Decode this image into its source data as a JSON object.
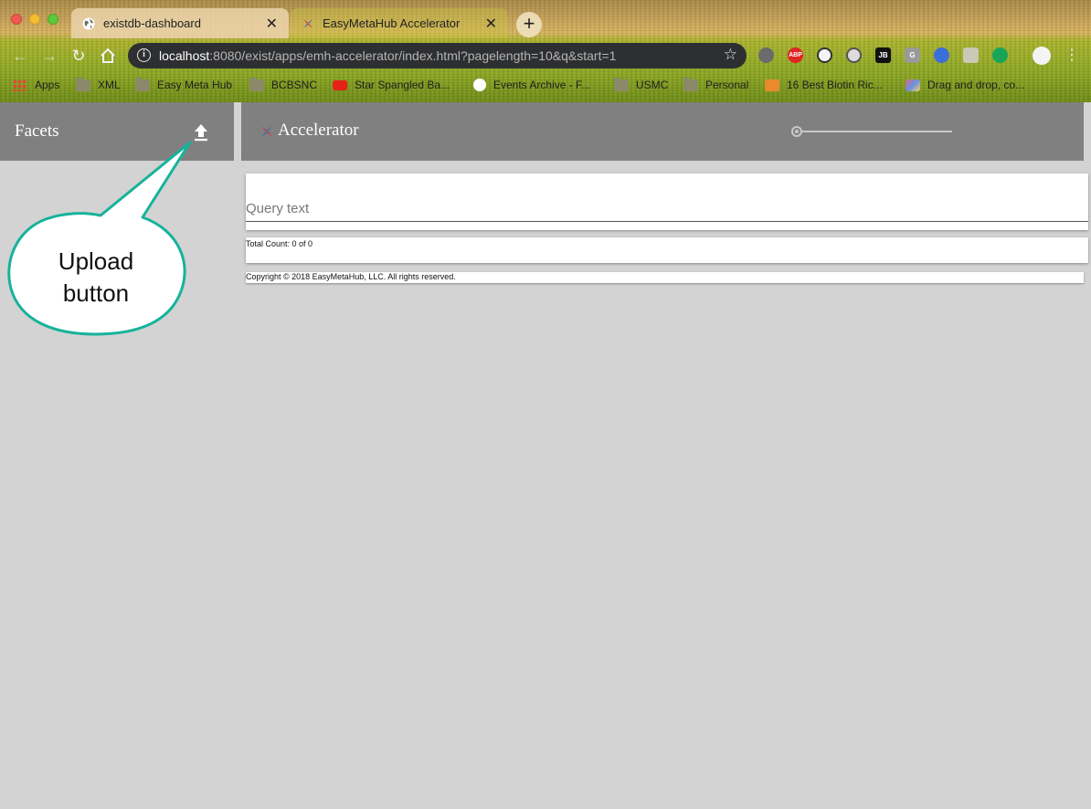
{
  "browser": {
    "tabs": [
      {
        "title": "existdb-dashboard",
        "active": false
      },
      {
        "title": "EasyMetaHub Accelerator",
        "active": true
      }
    ],
    "address": {
      "host": "localhost",
      "rest": ":8080/exist/apps/emh-accelerator/index.html?pagelength=10&q&start=1"
    },
    "extensions": [
      {
        "icon": "settings-extension-icon",
        "label": ""
      },
      {
        "icon": "adblock-plus-icon",
        "label": "ABP"
      },
      {
        "icon": "extension-icon",
        "label": ""
      },
      {
        "icon": "extension-icon",
        "label": ""
      },
      {
        "icon": "jetbrains-icon",
        "label": "JB"
      },
      {
        "icon": "g-extension-icon",
        "label": "G"
      },
      {
        "icon": "extension-icon",
        "label": ""
      },
      {
        "icon": "extension-icon",
        "label": ""
      },
      {
        "icon": "green-dot-extension-icon",
        "label": ""
      }
    ],
    "bookmarks": [
      {
        "label": "Apps",
        "icon": "apps-grid-icon"
      },
      {
        "label": "XML",
        "icon": "folder-icon"
      },
      {
        "label": "Easy Meta Hub",
        "icon": "folder-icon"
      },
      {
        "label": "BCBSNC",
        "icon": "folder-icon"
      },
      {
        "label": "Star Spangled Ba...",
        "icon": "youtube-icon"
      },
      {
        "label": "Events Archive - F...",
        "icon": "globe-icon"
      },
      {
        "label": "USMC",
        "icon": "folder-icon"
      },
      {
        "label": "Personal",
        "icon": "folder-icon"
      },
      {
        "label": "16 Best Biotin Ric...",
        "icon": "keto-site-icon"
      },
      {
        "label": "Drag and drop, co...",
        "icon": "cube-icon"
      }
    ]
  },
  "app": {
    "sidebar_title": "Facets",
    "title": "Accelerator",
    "query_placeholder": "Query text",
    "total_count": "Total Count: 0 of 0",
    "copyright": "Copyright © 2018 EasyMetaHub, LLC. All rights reserved."
  },
  "annotation": {
    "line1": "Upload",
    "line2": "button"
  },
  "colors": {
    "header_gray": "#808080",
    "page_background": "#d3d3d3",
    "callout_border": "#16b39a",
    "card_white": "#ffffff"
  }
}
